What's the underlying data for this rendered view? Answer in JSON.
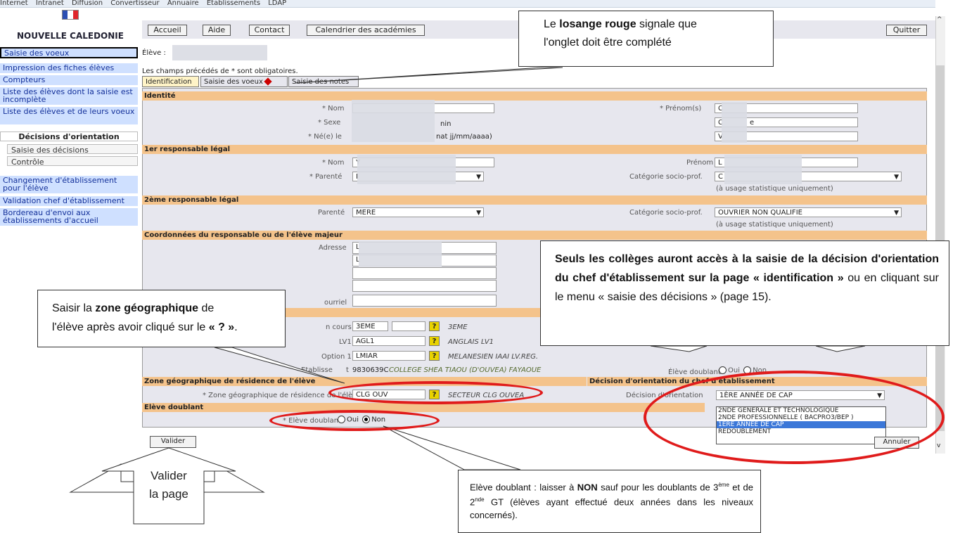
{
  "browser": {
    "toolbar_items": [
      "Internet",
      "Intranet",
      "Diffusion",
      "Convertisseur",
      "Annuaire",
      "Etablissements",
      "LDAP"
    ]
  },
  "header": {
    "org_name": "NOUVELLE CALEDONIE",
    "nav": [
      "Accueil",
      "Aide",
      "Contact",
      "Calendrier des académies"
    ],
    "quit_label": "Quitter"
  },
  "sidebar": {
    "items": [
      "Saisie des voeux",
      "Impression des fiches élèves",
      "Compteurs",
      "Liste des élèves dont la saisie est incomplète",
      "Liste des élèves et de leurs voeux"
    ],
    "decisions_header": "Décisions d'orientation",
    "decisions_items": [
      "Saisie des décisions",
      "Contrôle"
    ],
    "items2": [
      "Changement d'établissement pour l'élève",
      "Validation chef d'établissement",
      "Bordereau d'envoi aux établissements d'accueil"
    ]
  },
  "student": {
    "label": "Élève :",
    "required_note": "Les champs précédés de * sont obligatoires."
  },
  "tabs": [
    "Identification",
    "Saisie des voeux",
    "Saisie des notes"
  ],
  "identite": {
    "title": "Identité",
    "nom_label": "* Nom",
    "sexe_label": "* Sexe",
    "sexe_value_fragment": "nin",
    "ne_label": "* Né(e) le",
    "date_hint": "nat jj/mm/aaaa)",
    "prenoms_label": "* Prénom(s)",
    "prenom_vals": [
      "C",
      "C",
      "V"
    ],
    "prenom_suffix": "e"
  },
  "resp1": {
    "title": "1er responsable légal",
    "nom_label": "* Nom",
    "nom_value": "Y",
    "parente_label": "* Parenté",
    "parente_value": "I",
    "prenom_label": "Prénom",
    "prenom_value": "L",
    "cat_label": "Catégorie socio-prof.",
    "cat_value": "C",
    "cat_note": "(à usage statistique uniquement)"
  },
  "resp2": {
    "title": "2ème responsable légal",
    "parente_label": "Parenté",
    "parente_value": "MERE",
    "cat_label": "Catégorie socio-prof.",
    "cat_value": "OUVRIER NON QUALIFIE",
    "cat_note": "(à usage statistique uniquement)"
  },
  "coordonnees": {
    "title": "Coordonnées du responsable ou de l'élève majeur",
    "adresse_label": "Adresse",
    "adresse_lines": [
      "L",
      "L",
      "",
      ""
    ],
    "courriel_label": "ourriel"
  },
  "scolarite": {
    "classe_label": "n cours",
    "classe_value": "3EME",
    "classe_desc": "3EME",
    "lv1_label": "LV1",
    "lv1_value": "AGL1",
    "lv1_desc": "ANGLAIS LV1",
    "option_label": "Option 1",
    "option_value": "LMIAR",
    "option_desc": "MELANESIEN IAAI LV.REG.",
    "etab_label": "Etablisse",
    "etab_suffix": "t",
    "etab_value": "9830639C",
    "etab_desc": "COLLEGE SHEA TIAOU (D'OUVEA) FAYAOUE",
    "redoublant_label": "Élève doublant",
    "oui": "Oui",
    "non": "Non"
  },
  "zone": {
    "title": "Zone géographique de résidence de l'élève",
    "label": "* Zone géographique de résidence de l'élève",
    "value": "CLG OUV",
    "desc": "SECTEUR CLG OUVEA"
  },
  "decision": {
    "title": "Décision d'orientation du chef d'établissement",
    "label": "Décision d'orientation",
    "value": "1ÈRE ANNÉE DE CAP",
    "options": [
      "2NDE GENERALE ET TECHNOLOGIQUE",
      "2NDE PROFESSIONNELLE ( BACPRO3/BEP )",
      "1ÈRE ANNÉE DE CAP",
      "REDOUBLEMENT"
    ],
    "selected_index": 2
  },
  "doublant": {
    "title": "Elève doublant",
    "label": "* Elève doublant",
    "oui": "Oui",
    "non": "Non"
  },
  "buttons": {
    "valider": "Valider",
    "annuler": "Annuler"
  },
  "callouts": {
    "losange": [
      "Le ",
      "losange rouge",
      " signale que",
      "l'onglet doit être complété"
    ],
    "colleges": "Seuls les collèges auront accès à la saisie de la décision d'orientation du chef d'établissement sur la page",
    "colleges_b": "« identification »",
    "colleges_c": " ou en cliquant sur le menu « saisie des décisions » (page 15).",
    "zone_a": "Saisir la ",
    "zone_b": "zone géographique",
    "zone_c": " de",
    "zone_d": "l'élève après avoir cliqué sur le ",
    "zone_e": "« ? »",
    "zone_f": ".",
    "valider_a": "Valider",
    "valider_b": "la page",
    "doublant_a": "Elève doublant : laisser à ",
    "doublant_b": "NON",
    "doublant_c": " sauf pour les doublants de 3",
    "doublant_sup1": "ème",
    "doublant_d": " et de 2",
    "doublant_sup2": "nde",
    "doublant_e": " GT (élèves ayant effectué deux années dans les niveaux concernés)."
  },
  "colors": {
    "annotation_red": "#e01b1b",
    "section_band": "#f4c38b",
    "menu_bg": "#cfe0ff",
    "help_button": "#e8d200"
  }
}
